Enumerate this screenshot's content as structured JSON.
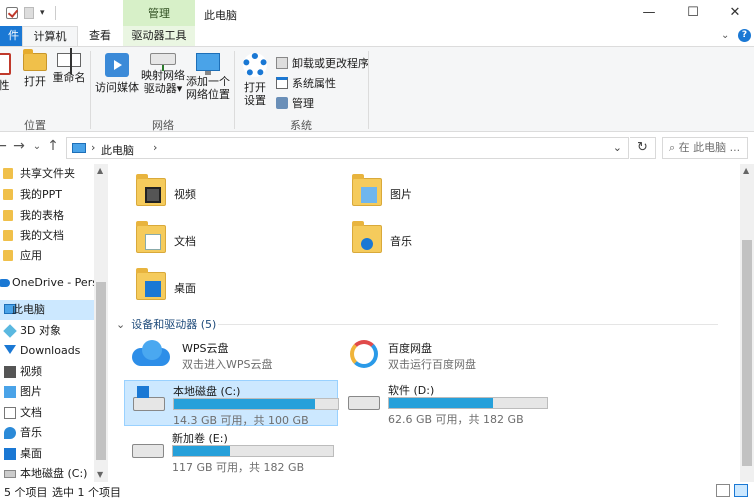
{
  "window": {
    "context_tab": "管理",
    "title": "此电脑",
    "minimize": "—",
    "maximize": "☐",
    "close": "✕"
  },
  "tabs": {
    "file": "件",
    "computer": "计算机",
    "view": "查看",
    "drive_tools": "驱动器工具",
    "collapse": "⌄",
    "help": "?"
  },
  "ribbon": {
    "properties_partial": "性",
    "open": "打开",
    "rename": "重命名",
    "access_media_line1": "访问媒体",
    "map_drive_line1": "映射网络",
    "map_drive_line2": "驱动器",
    "add_location_line1": "添加一个",
    "add_location_line2": "网络位置",
    "open_settings_line1": "打开",
    "open_settings_line2": "设置",
    "uninstall": "卸载或更改程序",
    "system_props": "系统属性",
    "manage": "管理",
    "group_location": "位置",
    "group_network": "网络",
    "group_system": "系统"
  },
  "address": {
    "back": "←",
    "forward": "→",
    "up": "↑",
    "breadcrumb": "此电脑",
    "search_placeholder": "在 此电脑 ...",
    "refresh": "↻"
  },
  "nav": {
    "items": [
      {
        "label": "共享文件夹",
        "icon": "folder-icon"
      },
      {
        "label": "我的PPT",
        "icon": "folder-icon"
      },
      {
        "label": "我的表格",
        "icon": "folder-icon"
      },
      {
        "label": "我的文档",
        "icon": "folder-icon"
      },
      {
        "label": "应用",
        "icon": "folder-icon"
      },
      {
        "label": "OneDrive - Perso",
        "icon": "onedrive-icon"
      },
      {
        "label": "此电脑",
        "icon": "pc-icon"
      },
      {
        "label": "3D 对象",
        "icon": "3d-objects-icon"
      },
      {
        "label": "Downloads",
        "icon": "downloads-icon"
      },
      {
        "label": "视频",
        "icon": "videos-icon"
      },
      {
        "label": "图片",
        "icon": "pictures-icon"
      },
      {
        "label": "文档",
        "icon": "documents-icon"
      },
      {
        "label": "音乐",
        "icon": "music-icon"
      },
      {
        "label": "桌面",
        "icon": "desktop-icon"
      },
      {
        "label": "本地磁盘 (C:)",
        "icon": "drive-icon"
      }
    ]
  },
  "folders": [
    {
      "name": "视频"
    },
    {
      "name": "图片"
    },
    {
      "name": "文档"
    },
    {
      "name": "音乐"
    },
    {
      "name": "桌面"
    }
  ],
  "devices": {
    "section_title": "设备和驱动器 (5)",
    "apps": [
      {
        "name": "WPS云盘",
        "sub": "双击进入WPS云盘"
      },
      {
        "name": "百度网盘",
        "sub": "双击运行百度网盘"
      }
    ],
    "drives": [
      {
        "name": "本地磁盘 (C:)",
        "sub": "14.3 GB 可用，共 100 GB",
        "used_fraction": 0.857
      },
      {
        "name": "软件 (D:)",
        "sub": "62.6 GB 可用，共 182 GB",
        "used_fraction": 0.656
      },
      {
        "name": "新加卷 (E:)",
        "sub": "117 GB 可用，共 182 GB",
        "used_fraction": 0.357
      }
    ]
  },
  "status": {
    "count": "5 个项目",
    "selected": "选中 1 个项目"
  },
  "colors": {
    "accent": "#1a78d4",
    "drive_bar": "#26a0da",
    "selection": "#cce8ff",
    "context_tab": "#d7f0c8"
  }
}
